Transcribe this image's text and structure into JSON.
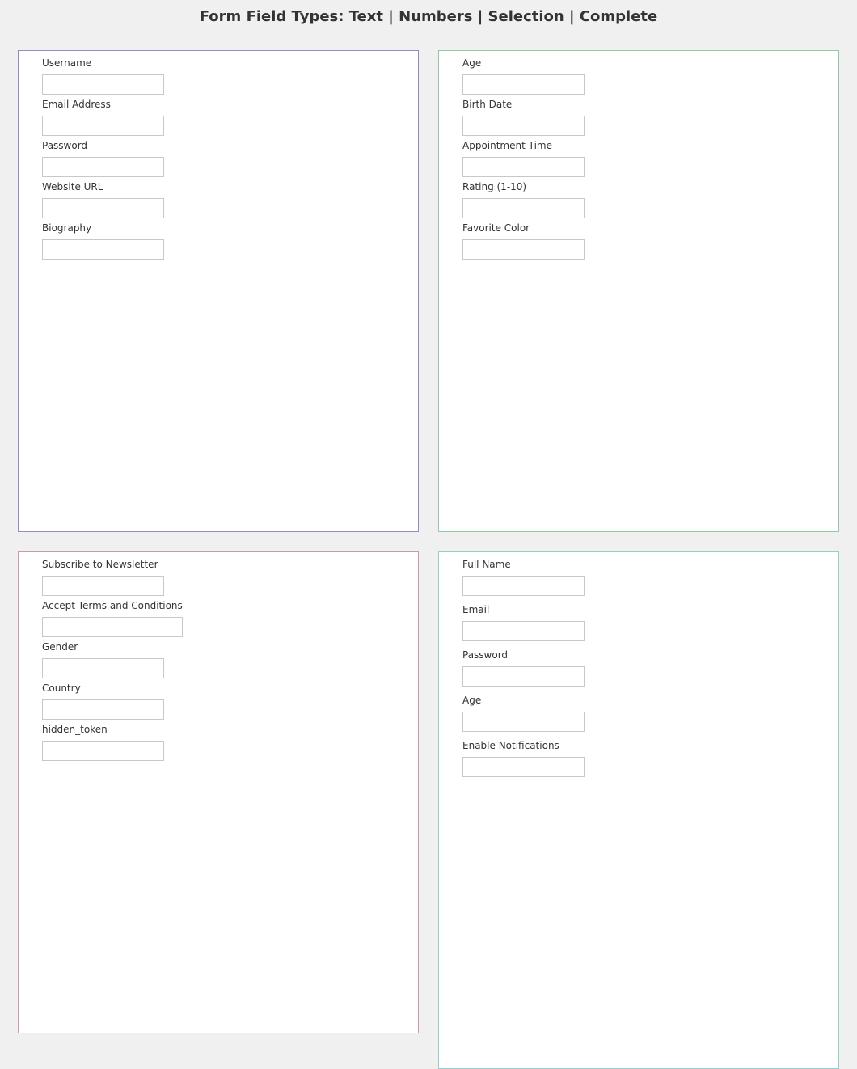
{
  "page": {
    "title": "Form Field Types: Text | Numbers | Selection | Complete"
  },
  "panels": {
    "text": {
      "fields": [
        {
          "label": "Username",
          "value": ""
        },
        {
          "label": "Email Address",
          "value": ""
        },
        {
          "label": "Password",
          "value": ""
        },
        {
          "label": "Website URL",
          "value": ""
        },
        {
          "label": "Biography",
          "value": ""
        }
      ]
    },
    "numbers": {
      "fields": [
        {
          "label": "Age",
          "value": ""
        },
        {
          "label": "Birth Date",
          "value": ""
        },
        {
          "label": "Appointment Time",
          "value": ""
        },
        {
          "label": "Rating (1-10)",
          "value": ""
        },
        {
          "label": "Favorite Color",
          "value": ""
        }
      ]
    },
    "selection": {
      "fields": [
        {
          "label": "Subscribe to Newsletter",
          "value": ""
        },
        {
          "label": "Accept Terms and Conditions",
          "value": ""
        },
        {
          "label": "Gender",
          "value": ""
        },
        {
          "label": "Country",
          "value": ""
        },
        {
          "label": "hidden_token",
          "value": ""
        }
      ]
    },
    "complete": {
      "fields": [
        {
          "label": "Full Name",
          "value": ""
        },
        {
          "label": "Email",
          "value": ""
        },
        {
          "label": "Password",
          "value": ""
        },
        {
          "label": "Age",
          "value": ""
        },
        {
          "label": "Enable Notifications",
          "value": ""
        }
      ]
    }
  },
  "colors": {
    "page_background": "#f0f0f0",
    "panel_background": "#ffffff",
    "text_panel_border": "#8f8cc8",
    "numbers_panel_border": "#8ec9a4",
    "selection_panel_border": "#cf9aa4",
    "complete_panel_border": "#94cfc9",
    "input_border": "#c8c8c8",
    "text": "#333333"
  }
}
